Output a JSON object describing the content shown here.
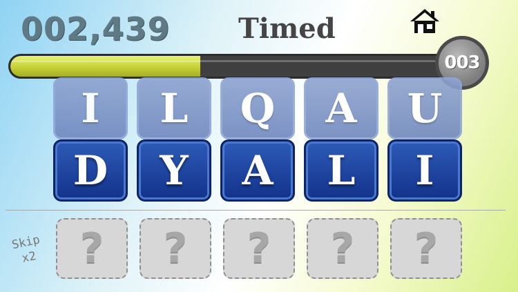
{
  "header": {
    "score": "002,439",
    "mode": "Timed",
    "home_icon": "home-icon"
  },
  "timer": {
    "progress": 0.42,
    "counter": "003"
  },
  "puzzle": {
    "upcoming_letters": [
      "I",
      "L",
      "Q",
      "A",
      "U"
    ],
    "current_letters": [
      "D",
      "Y",
      "A",
      "L",
      "I"
    ],
    "answer_slots": [
      "?",
      "?",
      "?",
      "?",
      "?"
    ]
  },
  "skip": {
    "line1": "Skip",
    "line2": "x2"
  },
  "colors": {
    "tile_active": "#1d45a0",
    "tile_faded": "#8096c8",
    "progress_fill": "#c9d33a",
    "progress_track": "#3f3f3f"
  }
}
